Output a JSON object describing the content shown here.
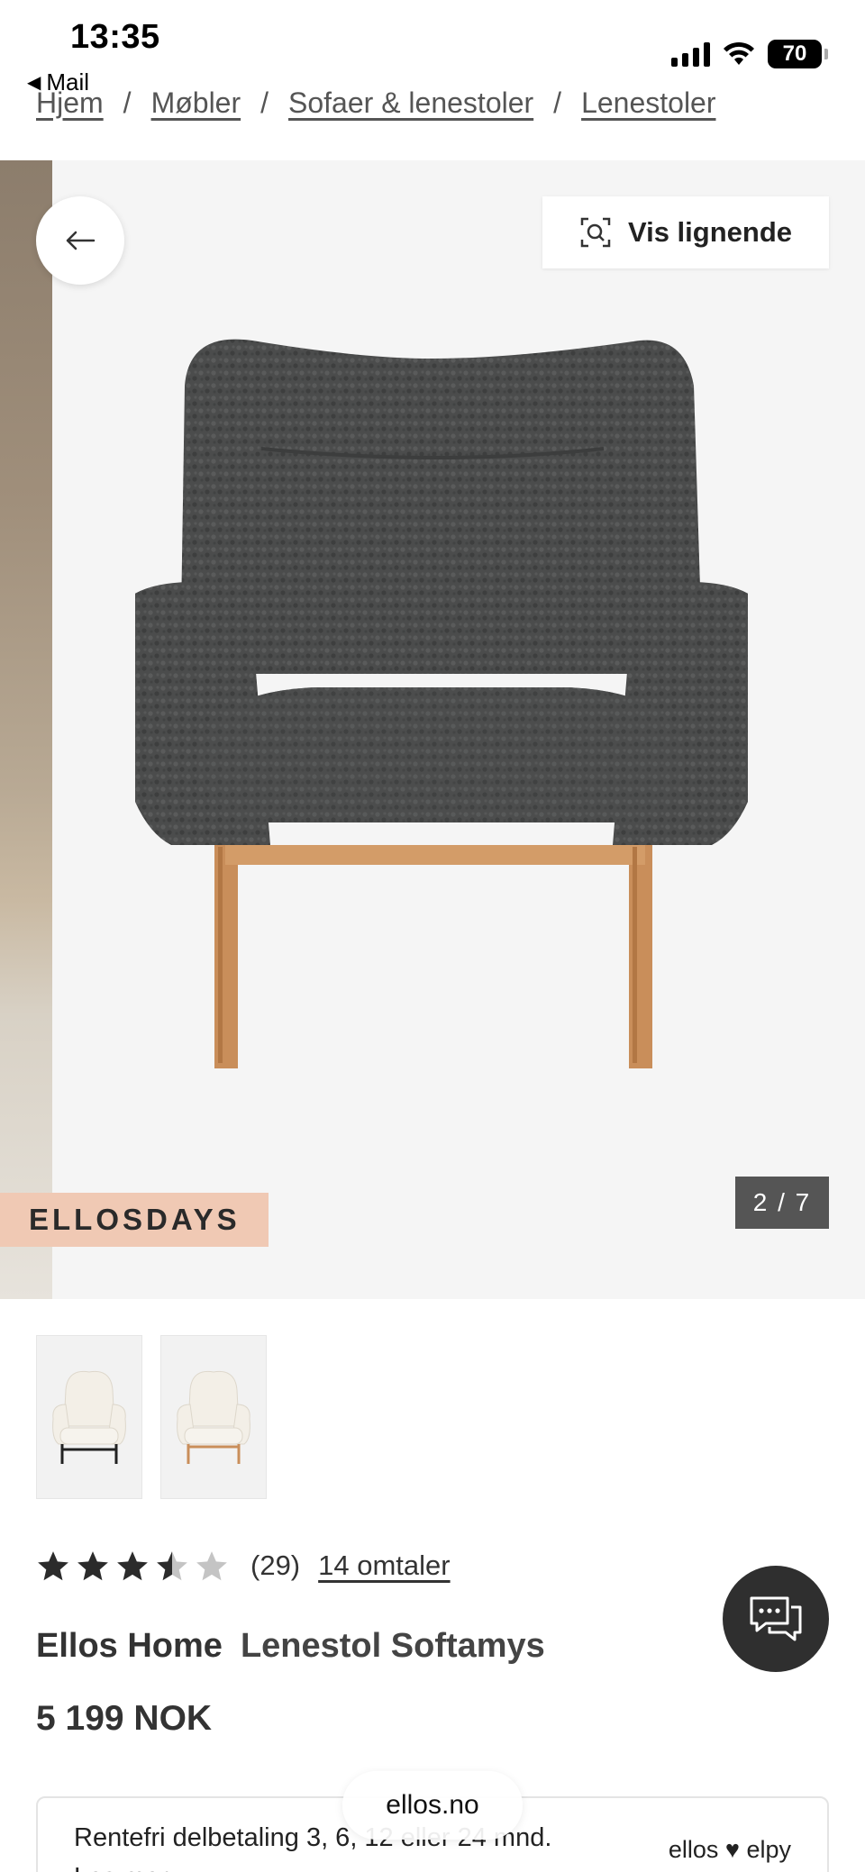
{
  "status_bar": {
    "time": "13:35",
    "back_app": "Mail",
    "battery": "70"
  },
  "breadcrumb": {
    "items": [
      "Hjem",
      "Møbler",
      "Sofaer & lenestoler",
      "Lenestoler"
    ],
    "separator": "/"
  },
  "gallery": {
    "similar_label": "Vis lignende",
    "promo_badge": "ELLOSDAYS",
    "counter": "2 / 7",
    "current_image": 2,
    "total_images": 7,
    "chair_color": "#4a4b4b",
    "wood_color": "#c98e5a"
  },
  "rating": {
    "stars": 3.5,
    "max_stars": 5,
    "count": "(29)",
    "reviews_label": "14 omtaler"
  },
  "product": {
    "brand": "Ellos Home",
    "name": "Lenestol Softamys",
    "price": "5 199 NOK"
  },
  "financing": {
    "text": "Rentefri delbetaling 3, 6, 12 eller 24 mnd.",
    "more_label": "Les mer",
    "partner": "ellos ♥ elpy"
  },
  "browser": {
    "url": "ellos.no"
  },
  "colors": {
    "promo_badge_bg": "#f0c9b4",
    "chat_bg": "#2f2f2f",
    "counter_bg": "#555555"
  }
}
